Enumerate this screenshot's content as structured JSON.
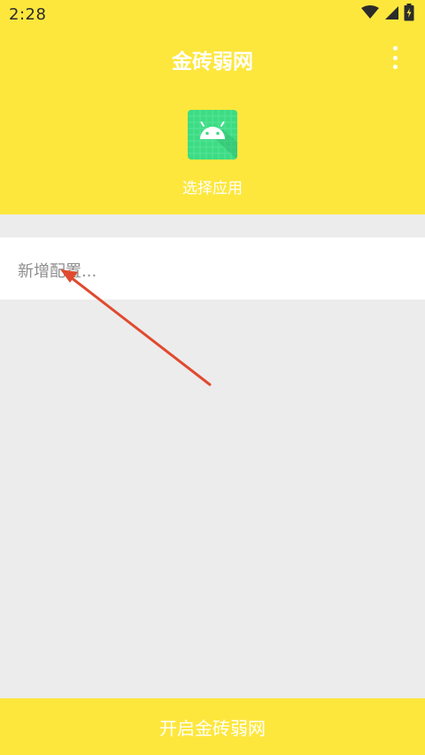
{
  "status_bar": {
    "time": "2:28",
    "icons": [
      "wifi-icon",
      "cell-signal-icon",
      "battery-charging-icon"
    ]
  },
  "header": {
    "title": "金砖弱网",
    "menu_icon": "more-vert-icon",
    "app_icon": "android-icon",
    "pick_label": "选择应用"
  },
  "config": {
    "placeholder": "新增配置..."
  },
  "bottom_button": {
    "label": "开启金砖弱网"
  },
  "colors": {
    "accent": "#fde73d",
    "background": "#ececec",
    "app_icon_bg": "#3ddc84",
    "annotation_arrow": "#e04a2f"
  }
}
